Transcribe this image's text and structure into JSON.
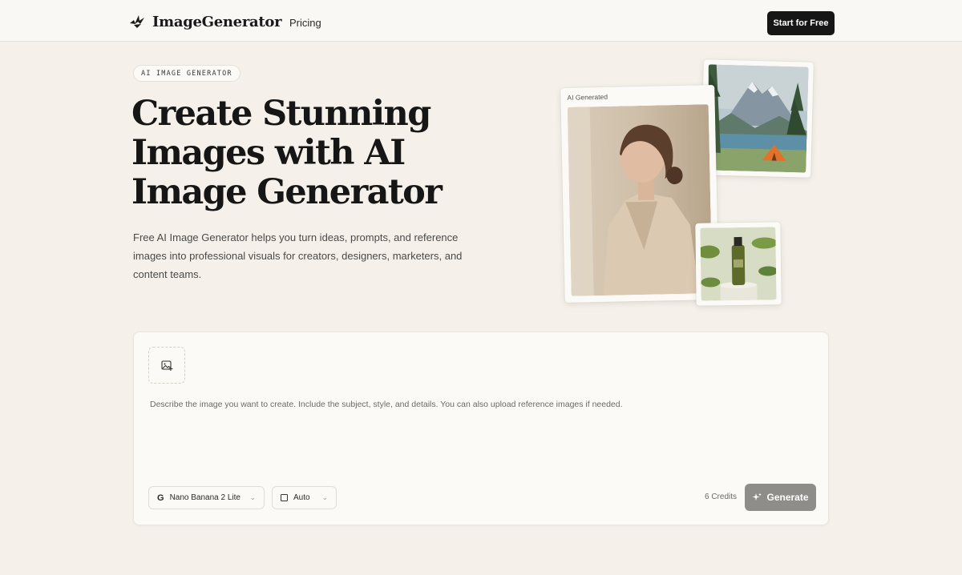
{
  "header": {
    "brand": "ImageGenerator",
    "nav_pricing": "Pricing",
    "cta": "Start for Free"
  },
  "hero": {
    "badge": "AI IMAGE GENERATOR",
    "title_line1": "Create Stunning",
    "title_line2": "Images with AI",
    "title_line3": "Image Generator",
    "subtitle": "Free AI Image Generator helps you turn ideas, prompts, and reference images into professional visuals for creators, designers, marketers, and content teams."
  },
  "gallery": {
    "portrait_label": "AI Generated"
  },
  "generator": {
    "prompt_placeholder": "Describe the image you want to create. Include the subject, style, and details. You can also upload reference images if needed.",
    "model_icon": "G",
    "model": "Nano Banana 2 Lite",
    "ratio": "Auto",
    "credits": "6 Credits",
    "generate_label": "Generate"
  },
  "icons": {
    "logo": "bird-logo-icon",
    "upload": "image-add-icon",
    "generate": "sparkles-icon",
    "dropdown": "chevron-down-icon"
  },
  "colors": {
    "background": "#f5f1ea",
    "primary_button": "#161616",
    "generate_button": "#8f8d8a"
  }
}
